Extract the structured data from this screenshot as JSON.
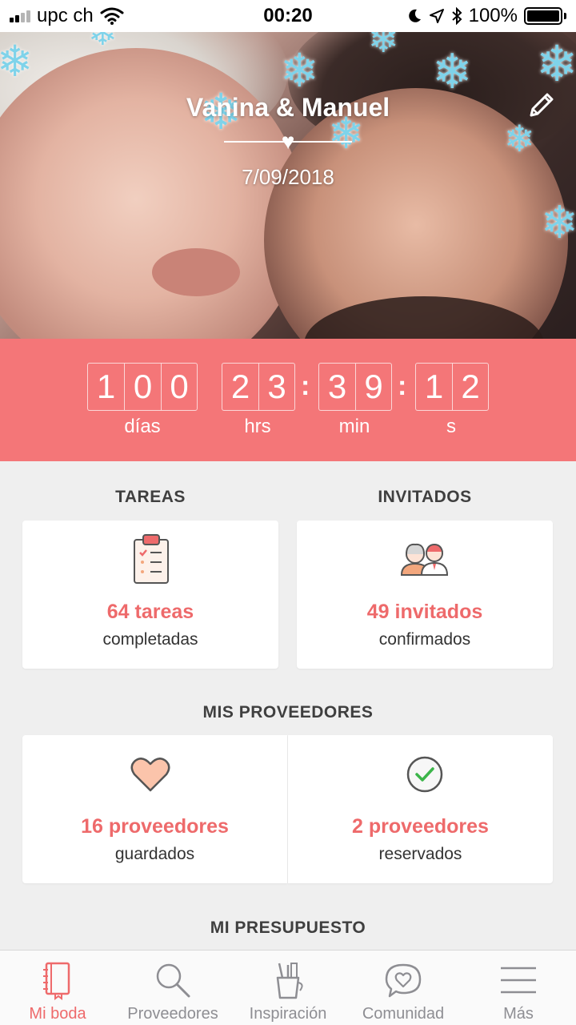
{
  "status": {
    "carrier": "upc ch",
    "time": "00:20",
    "battery": "100%"
  },
  "hero": {
    "couple": "Vanina & Manuel",
    "date": "7/09/2018"
  },
  "countdown": {
    "days": [
      "1",
      "0",
      "0"
    ],
    "hours": [
      "2",
      "3"
    ],
    "minutes": [
      "3",
      "9"
    ],
    "seconds": [
      "1",
      "2"
    ],
    "separator": ":",
    "labels": {
      "days": "días",
      "hours": "hrs",
      "minutes": "min",
      "seconds": "s"
    }
  },
  "tasks": {
    "title": "TAREAS",
    "value": "64 tareas",
    "sub": "completadas"
  },
  "guests": {
    "title": "INVITADOS",
    "value": "49 invitados",
    "sub": "confirmados"
  },
  "vendors": {
    "title": "MIS PROVEEDORES",
    "saved_value": "16 proveedores",
    "saved_sub": "guardados",
    "booked_value": "2 proveedores",
    "booked_sub": "reservados"
  },
  "budget": {
    "title": "MI PRESUPUESTO"
  },
  "tabs": [
    {
      "label": "Mi boda",
      "icon": "notebook-icon"
    },
    {
      "label": "Proveedores",
      "icon": "search-icon"
    },
    {
      "label": "Inspiración",
      "icon": "pencil-cup-icon"
    },
    {
      "label": "Comunidad",
      "icon": "chat-heart-icon"
    },
    {
      "label": "Más",
      "icon": "menu-icon"
    }
  ],
  "colors": {
    "accent": "#f47678",
    "accent_text": "#ee6a6b",
    "background": "#efefef"
  }
}
